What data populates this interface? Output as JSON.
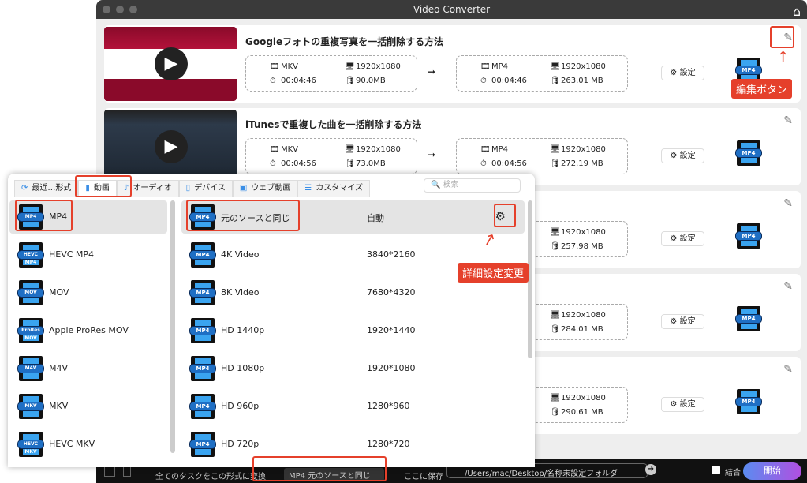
{
  "window": {
    "title": "Video Converter"
  },
  "tasks": [
    {
      "title": "Googleフォトの重複写真を一括削除する方法",
      "src_format": "MKV",
      "src_res": "1920x1080",
      "src_dur": "00:04:46",
      "src_size": "90.0MB",
      "dst_format": "MP4",
      "dst_res": "1920x1080",
      "dst_dur": "00:04:46",
      "dst_size": "263.01 MB",
      "settings": "設定",
      "fmt_icon": "MP4"
    },
    {
      "title": "iTunesで重複した曲を一括削除する方法",
      "src_format": "MKV",
      "src_res": "1920x1080",
      "src_dur": "00:04:56",
      "src_size": "73.0MB",
      "dst_format": "MP4",
      "dst_res": "1920x1080",
      "dst_dur": "00:04:56",
      "dst_size": "272.19 MB",
      "settings": "設定",
      "fmt_icon": "MP4"
    },
    {
      "dst_res": "1920x1080",
      "dst_size": "257.98 MB",
      "settings": "設定",
      "fmt_icon": "MP4"
    },
    {
      "dst_res": "1920x1080",
      "dst_size": "284.01 MB",
      "settings": "設定",
      "fmt_icon": "MP4"
    },
    {
      "dst_res": "1920x1080",
      "dst_size": "290.61 MB",
      "settings": "設定",
      "fmt_icon": "MP4"
    }
  ],
  "annotations": {
    "edit": "編集ボタン",
    "detail": "詳細設定変更"
  },
  "popup": {
    "tabs": [
      {
        "label": "最近…形式",
        "icon": "recent-icon"
      },
      {
        "label": "動画",
        "icon": "video-icon"
      },
      {
        "label": "オーディオ",
        "icon": "audio-icon"
      },
      {
        "label": "デバイス",
        "icon": "device-icon"
      },
      {
        "label": "ウェブ動画",
        "icon": "web-video-icon"
      },
      {
        "label": "カスタマイズ",
        "icon": "customize-icon"
      }
    ],
    "search_placeholder": "検索",
    "formats": [
      {
        "icon": "MP4",
        "label": "MP4"
      },
      {
        "icon": "HEVC MP4",
        "label": "HEVC MP4"
      },
      {
        "icon": "MOV",
        "label": "MOV"
      },
      {
        "icon": "ProRes MOV",
        "label": "Apple ProRes MOV"
      },
      {
        "icon": "M4V",
        "label": "M4V"
      },
      {
        "icon": "MKV",
        "label": "MKV"
      },
      {
        "icon": "HEVC MKV",
        "label": "HEVC MKV"
      }
    ],
    "presets": [
      {
        "label": "元のソースと同じ",
        "res": "自動"
      },
      {
        "label": "4K Video",
        "res": "3840*2160"
      },
      {
        "label": "8K Video",
        "res": "7680*4320"
      },
      {
        "label": "HD 1440p",
        "res": "1920*1440"
      },
      {
        "label": "HD 1080p",
        "res": "1920*1080"
      },
      {
        "label": "HD 960p",
        "res": "1280*960"
      },
      {
        "label": "HD 720p",
        "res": "1280*720"
      }
    ]
  },
  "bottom": {
    "convert_all": "全てのタスクをこの形式に変換",
    "format_select": "MP4 元のソースと同じ",
    "save_to": "ここに保存",
    "path": "/Users/mac/Desktop/名称未設定フォルダ",
    "merge": "結合",
    "start": "開始"
  }
}
